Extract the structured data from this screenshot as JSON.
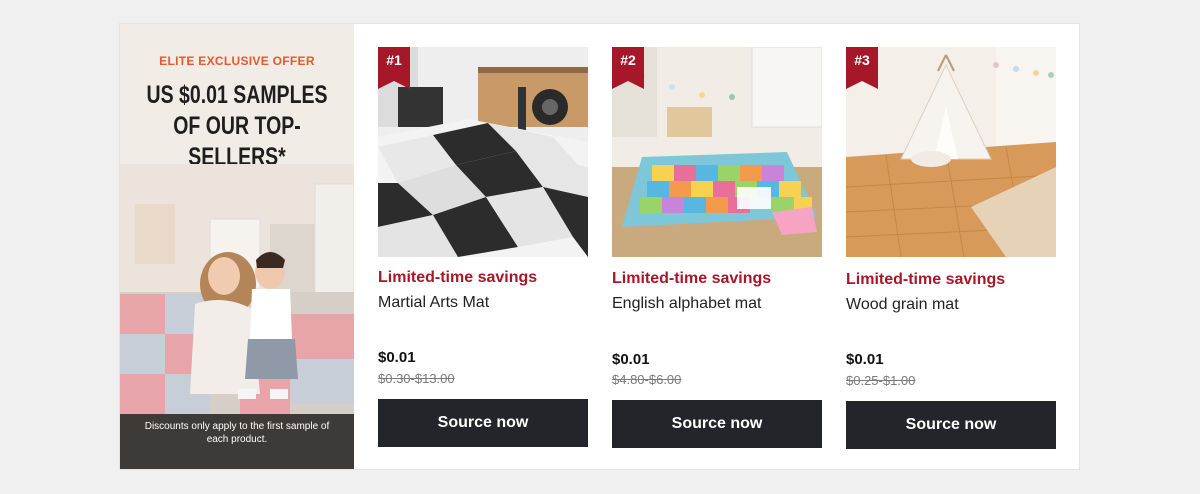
{
  "promo": {
    "kicker": "ELITE EXCLUSIVE OFFER",
    "headline_line1": "US $0.01 SAMPLES",
    "headline_line2": "OF OUR TOP-SELLERS*",
    "footnote": "Discounts only apply to the first sample of each product.",
    "image": "mother-and-child-on-foam-mat-photo"
  },
  "products": [
    {
      "rank": "#1",
      "badge": "Limited-time savings",
      "name": "Martial Arts Mat",
      "price": "$0.01",
      "original_price": "$0.30-$13.00",
      "cta": "Source now",
      "image": "gym-checkered-foam-mat-photo"
    },
    {
      "rank": "#2",
      "badge": "Limited-time savings",
      "name": "English alphabet mat",
      "price": "$0.01",
      "original_price": "$4.80-$6.00",
      "cta": "Source now",
      "image": "alphabet-puzzle-mat-photo"
    },
    {
      "rank": "#3",
      "badge": "Limited-time savings",
      "name": "Wood grain mat",
      "price": "$0.01",
      "original_price": "$0.25-$1.00",
      "cta": "Source now",
      "image": "wood-grain-mat-teepee-photo"
    }
  ],
  "colors": {
    "accent_orange": "#e5592a",
    "deal_red": "#a7172a",
    "rank_badge": "#a7172a",
    "button_bg": "#23252a"
  }
}
